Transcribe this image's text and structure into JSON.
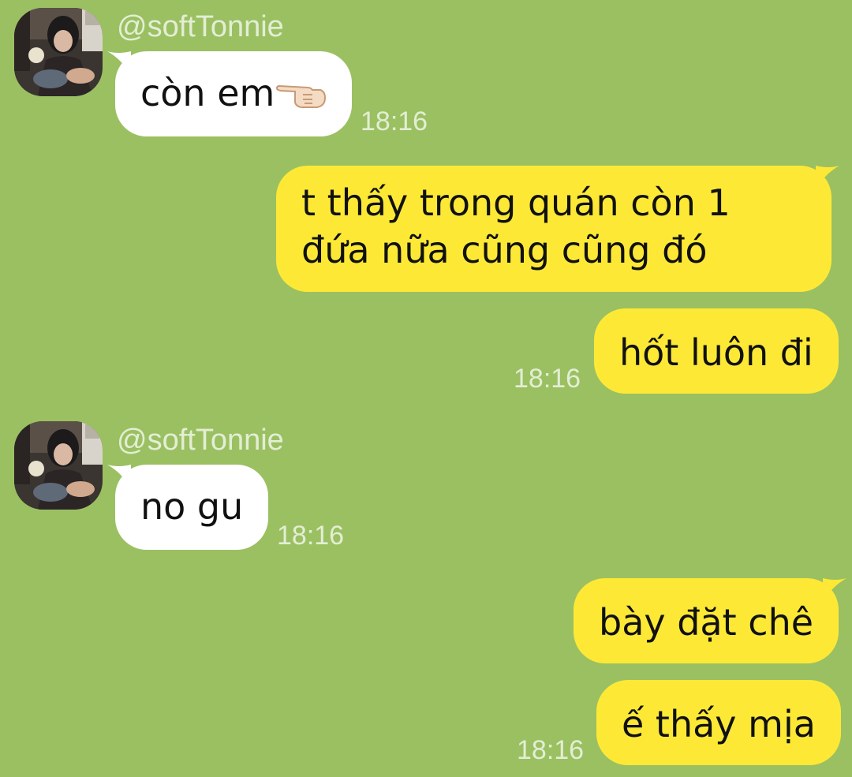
{
  "messages": [
    {
      "side": "in",
      "sender": "@softTonnie",
      "text": "còn em",
      "has_pointing_emoji": true,
      "time": "18:16"
    },
    {
      "side": "out",
      "text": "t thấy trong quán còn 1 đứa nữa cũng cũng đó"
    },
    {
      "side": "out",
      "text": "hốt luôn đi",
      "time": "18:16"
    },
    {
      "side": "in",
      "sender": "@softTonnie",
      "text": "no gu",
      "time": "18:16"
    },
    {
      "side": "out",
      "text": "bày đặt chê"
    },
    {
      "side": "out",
      "text": "ế thấy mịa",
      "time": "18:16"
    }
  ],
  "colors": {
    "background": "#9bc062",
    "incoming_bubble": "#ffffff",
    "outgoing_bubble": "#fde935",
    "meta_text": "#e3eed4"
  },
  "icons": {
    "pointing_emoji": "backhand-index-pointing-right-icon",
    "avatar": "profile-photo-avatar"
  }
}
